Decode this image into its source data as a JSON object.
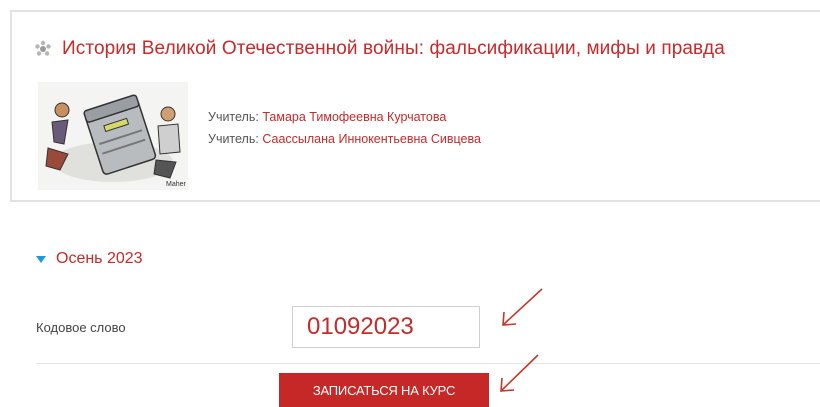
{
  "course": {
    "title": "История Великой Отечественной войны: фальсификации, мифы и правда",
    "icon": "course-icon",
    "teachers": [
      {
        "role": "Учитель:",
        "name": "Тамара Тимофеевна Курчатова"
      },
      {
        "role": "Учитель:",
        "name": "Саассылана Иннокентьевна Сивцева"
      }
    ]
  },
  "enrolment": {
    "section_title": "Осень 2023",
    "field_label": "Кодовое слово",
    "code_value": "01092023",
    "submit_label": "ЗАПИСАТЬСЯ НА КУРС"
  },
  "colors": {
    "accent": "#c62a2a",
    "caret": "#1a9ad6",
    "button": "#c62828"
  }
}
